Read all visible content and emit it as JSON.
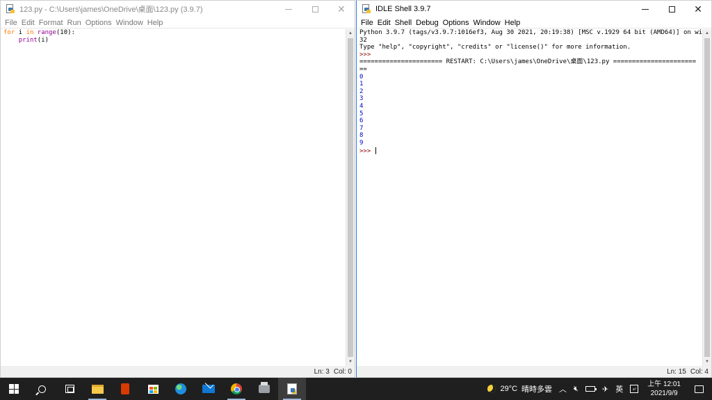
{
  "editor": {
    "title": "123.py - C:\\Users\\james\\OneDrive\\桌面\\123.py (3.9.7)",
    "menu": [
      "File",
      "Edit",
      "Format",
      "Run",
      "Options",
      "Window",
      "Help"
    ],
    "code": {
      "line1": {
        "kw1": "for",
        "t1": " i ",
        "kw2": "in",
        "t2": " ",
        "bi": "range",
        "t3": "(10):"
      },
      "line2": {
        "indent": "    ",
        "bi": "print",
        "t": "(i)"
      }
    },
    "status": {
      "ln": "Ln: 3",
      "col": "Col: 0"
    }
  },
  "shell": {
    "title": "IDLE Shell 3.9.7",
    "menu": [
      "File",
      "Edit",
      "Shell",
      "Debug",
      "Options",
      "Window",
      "Help"
    ],
    "banner_line1": "Python 3.9.7 (tags/v3.9.7:1016ef3, Aug 30 2021, 20:19:38) [MSC v.1929 64 bit (AMD64)] on win",
    "banner_line2": "32",
    "banner_line3": "Type \"help\", \"copyright\", \"credits\" or \"license()\" for more information.",
    "prompt1": ">>>",
    "restart_line1": "====================== RESTART: C:\\Users\\james\\OneDrive\\桌面\\123.py ======================",
    "restart_line2": "==",
    "output": [
      "0",
      "1",
      "2",
      "3",
      "4",
      "5",
      "6",
      "7",
      "8",
      "9"
    ],
    "prompt2": ">>> ",
    "status": {
      "ln": "Ln: 15",
      "col": "Col: 4"
    }
  },
  "taskbar": {
    "weather_temp": "29°C",
    "weather_desc": "晴時多雲",
    "ime": "英",
    "clock_time": "上午 12:01",
    "clock_date": "2021/9/9",
    "icons": [
      "start-icon",
      "search-icon",
      "task-view-icon",
      "file-explorer-icon",
      "office-icon",
      "store-icon",
      "edge-icon",
      "mail-icon",
      "chrome-icon",
      "printer-icon",
      "idle-icon"
    ]
  }
}
